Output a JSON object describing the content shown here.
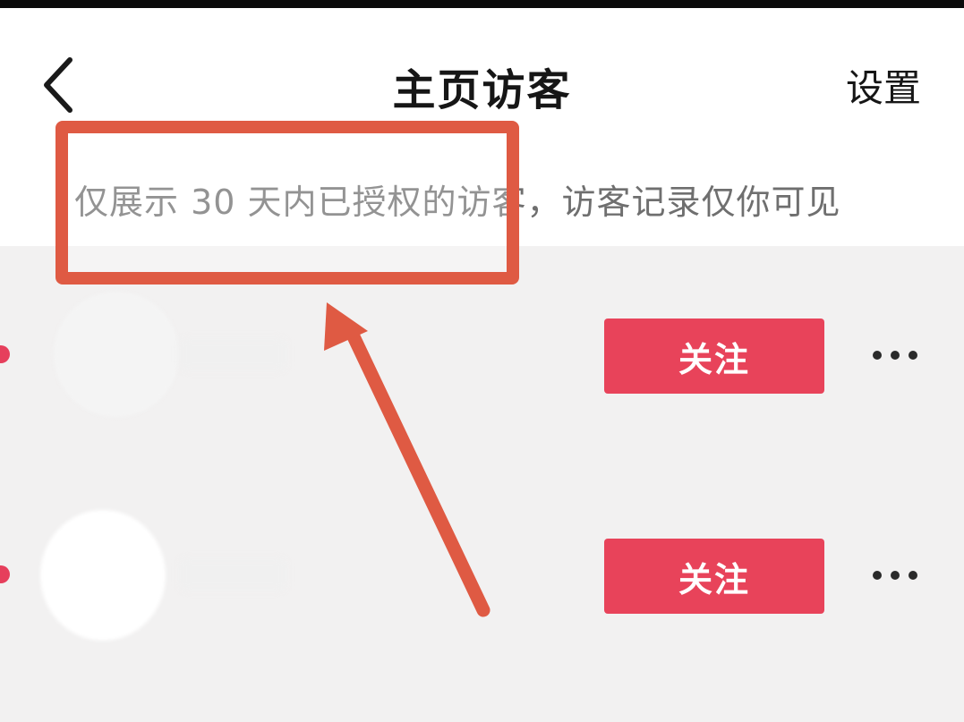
{
  "header": {
    "title": "主页访客",
    "settings_label": "设置",
    "back_icon": "chevron-left-icon"
  },
  "notice": {
    "text": "仅展示 30 天内已授权的访客，访客记录仅你可见"
  },
  "visitors": [
    {
      "follow_label": "关注",
      "more_icon": "more-horizontal-icon",
      "unread": true
    },
    {
      "follow_label": "关注",
      "more_icon": "more-horizontal-icon",
      "unread": true
    }
  ],
  "annotation": {
    "box_color": "#df5a43",
    "arrow_color": "#df5a43"
  },
  "colors": {
    "follow_button": "#e8435a",
    "unread_dot": "#e63f5c",
    "background": "#f2f1f1"
  }
}
